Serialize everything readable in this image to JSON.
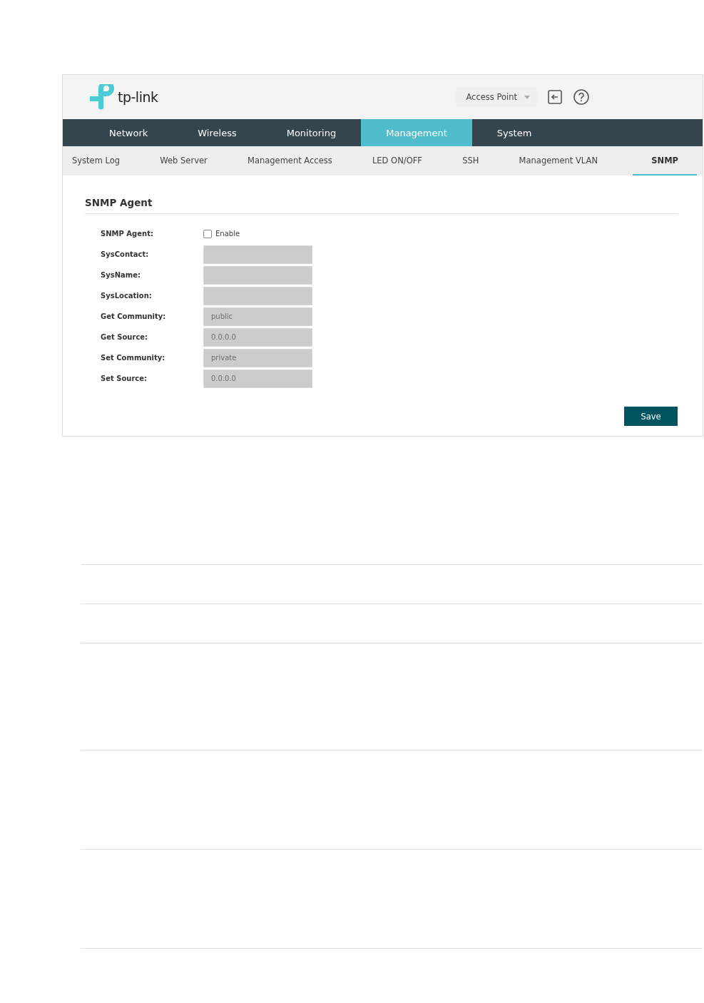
{
  "header": {
    "logo": "tp-link",
    "mode_select": {
      "value": "Access Point"
    }
  },
  "main_tabs": [
    {
      "label": "Network",
      "selected": false
    },
    {
      "label": "Wireless",
      "selected": false
    },
    {
      "label": "Monitoring",
      "selected": false
    },
    {
      "label": "Management",
      "selected": true
    },
    {
      "label": "System",
      "selected": false
    }
  ],
  "sub_tabs": [
    {
      "label": "System Log",
      "selected": false
    },
    {
      "label": "Web Server",
      "selected": false
    },
    {
      "label": "Management Access",
      "selected": false
    },
    {
      "label": "LED ON/OFF",
      "selected": false
    },
    {
      "label": "SSH",
      "selected": false
    },
    {
      "label": "Management VLAN",
      "selected": false
    },
    {
      "label": "SNMP",
      "selected": true
    }
  ],
  "section": {
    "title": "SNMP Agent"
  },
  "form": [
    {
      "kind": "checkbox",
      "label": "SNMP Agent:",
      "option": "Enable",
      "checked": false
    },
    {
      "kind": "field",
      "label": "SysContact:",
      "disabled": true
    },
    {
      "kind": "field",
      "label": "SysName:",
      "disabled": true
    },
    {
      "kind": "field",
      "label": "SysLocation:",
      "disabled": true
    },
    {
      "kind": "field",
      "label": "Get Community:",
      "placeholder": "public",
      "disabled": true
    },
    {
      "kind": "field",
      "label": "Get Source:",
      "placeholder": "0.0.0.0",
      "disabled": true
    },
    {
      "kind": "field",
      "label": "Set Community:",
      "placeholder": "private",
      "disabled": true
    },
    {
      "kind": "field",
      "label": "Set Source:",
      "placeholder": "0.0.0.0",
      "disabled": true
    }
  ],
  "buttons": [
    "Save"
  ]
}
